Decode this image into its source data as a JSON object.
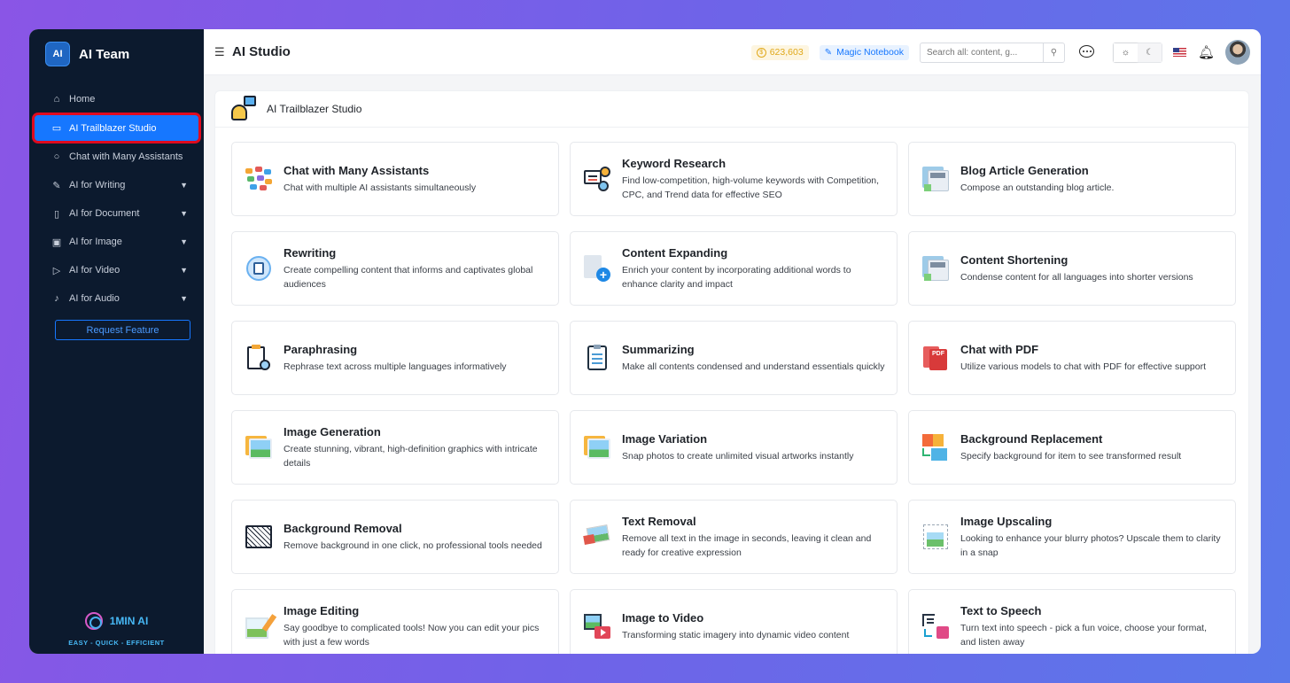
{
  "sidebar": {
    "brand_logo": "AI",
    "brand_name": "AI Team",
    "items": [
      {
        "label": "Home",
        "icon": "home-icon",
        "has_chevron": false
      },
      {
        "label": "AI Trailblazer Studio",
        "icon": "monitor-icon",
        "has_chevron": false,
        "active": true
      },
      {
        "label": "Chat with Many Assistants",
        "icon": "chat-icon",
        "has_chevron": false
      },
      {
        "label": "AI for Writing",
        "icon": "pen-square-icon",
        "has_chevron": true
      },
      {
        "label": "AI for Document",
        "icon": "document-icon",
        "has_chevron": true
      },
      {
        "label": "AI for Image",
        "icon": "image-icon",
        "has_chevron": true
      },
      {
        "label": "AI for Video",
        "icon": "video-icon",
        "has_chevron": true
      },
      {
        "label": "AI for Audio",
        "icon": "microphone-icon",
        "has_chevron": true
      }
    ],
    "request_feature": "Request Feature",
    "footer_brand": "1MIN AI",
    "footer_tagline": "EASY - QUICK - EFFICIENT"
  },
  "topbar": {
    "title": "AI Studio",
    "credits_symbol": "$",
    "credits": "623,603",
    "magic_notebook": "Magic Notebook",
    "search_placeholder": "Search all: content, g...",
    "theme_light_icon": "☼",
    "theme_dark_icon": "☾"
  },
  "panel": {
    "title": "AI Trailblazer Studio"
  },
  "cards": [
    {
      "title": "Chat with Many Assistants",
      "desc": "Chat with multiple AI assistants simultaneously",
      "icon": "multi-chat-icon"
    },
    {
      "title": "Keyword Research",
      "desc": "Find low-competition, high-volume keywords with Competition, CPC, and Trend data for effective SEO",
      "icon": "keyword-research-icon"
    },
    {
      "title": "Blog Article Generation",
      "desc": "Compose an outstanding blog article.",
      "icon": "blog-icon"
    },
    {
      "title": "Rewriting",
      "desc": "Create compelling content that informs and captivates global audiences",
      "icon": "rewrite-icon"
    },
    {
      "title": "Content Expanding",
      "desc": "Enrich your content by incorporating additional words to enhance clarity and impact",
      "icon": "document-plus-icon"
    },
    {
      "title": "Content Shortening",
      "desc": "Condense content for all languages into shorter versions",
      "icon": "blog-icon"
    },
    {
      "title": "Paraphrasing",
      "desc": "Rephrase text across multiple languages informatively",
      "icon": "paraphrase-icon"
    },
    {
      "title": "Summarizing",
      "desc": "Make all contents condensed and understand essentials quickly",
      "icon": "clipboard-icon"
    },
    {
      "title": "Chat with PDF",
      "desc": "Utilize various models to chat with PDF for effective support",
      "icon": "pdf-icon"
    },
    {
      "title": "Image Generation",
      "desc": "Create stunning, vibrant, high-definition graphics with intricate details",
      "icon": "image-generation-icon"
    },
    {
      "title": "Image Variation",
      "desc": "Snap photos to create unlimited visual artworks instantly",
      "icon": "image-variation-icon"
    },
    {
      "title": "Background Replacement",
      "desc": "Specify background for item to see transformed result",
      "icon": "background-replace-icon"
    },
    {
      "title": "Background Removal",
      "desc": "Remove background in one click, no professional tools needed",
      "icon": "background-removal-icon"
    },
    {
      "title": "Text Removal",
      "desc": "Remove all text in the image in seconds, leaving it clean and ready for creative expression",
      "icon": "text-removal-icon"
    },
    {
      "title": "Image Upscaling",
      "desc": "Looking to enhance your blurry photos? Upscale them to clarity in a snap",
      "icon": "upscale-icon"
    },
    {
      "title": "Image Editing",
      "desc": "Say goodbye to complicated tools! Now you can edit your pics with just a few words",
      "icon": "image-edit-icon"
    },
    {
      "title": "Image to Video",
      "desc": "Transforming static imagery into dynamic video content",
      "icon": "image-to-video-icon"
    },
    {
      "title": "Text to Speech",
      "desc": "Turn text into speech - pick a fun voice, choose your format, and listen away",
      "icon": "text-to-speech-icon"
    }
  ]
}
